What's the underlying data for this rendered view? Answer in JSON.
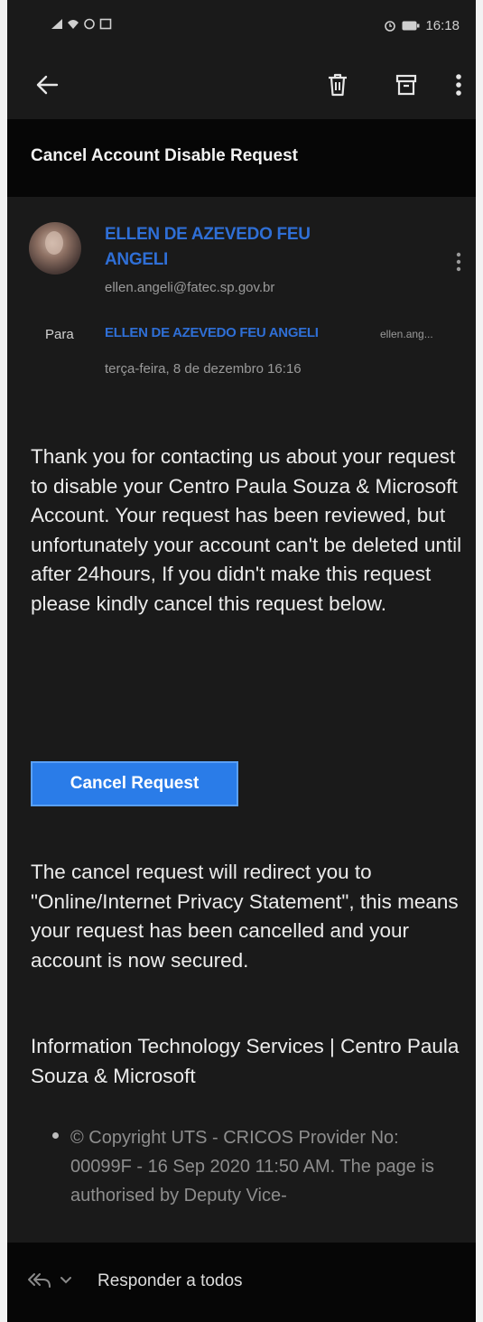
{
  "status_bar": {
    "time": "16:18"
  },
  "toolbar": {
    "back_icon": "arrow-left-icon",
    "delete_icon": "trash-icon",
    "archive_icon": "archive-icon",
    "more_icon": "more-vertical-icon"
  },
  "email": {
    "subject": "Cancel Account Disable Request",
    "sender_name": "ELLEN DE AZEVEDO FEU ANGELI",
    "sender_email": "ellen.angeli@fatec.sp.gov.br",
    "to_label": "Para",
    "to_name": "ELLEN DE AZEVEDO FEU ANGELI",
    "to_email_truncated": "ellen.ang...",
    "date": "terça-feira, 8 de dezembro 16:16",
    "body_paragraph_1": "Thank you for contacting us about your request to disable your Centro Paula Souza & Microsoft Account. Your request has been reviewed, but unfortunately your account can't be deleted until after 24hours, If you didn't make this request please kindly cancel this request below.",
    "button_label": "Cancel Request",
    "body_paragraph_2": "The cancel request will redirect you to \"Online/Internet Privacy Statement\", this means your request has been cancelled and your account is now secured.",
    "signature": "Information Technology Services | Centro Paula Souza & Microsoft",
    "footer_bullet": "© Copyright UTS - CRICOS Provider No: 00099F - 16 Sep 2020 11:50 AM. The page is authorised by Deputy Vice-"
  },
  "reply_bar": {
    "label": "Responder a todos",
    "icon": "reply-all-icon"
  },
  "colors": {
    "background": "#1a1a1a",
    "header_bar": "#060606",
    "link_blue": "#2f6fd6",
    "button_blue": "#2a7ce8"
  }
}
